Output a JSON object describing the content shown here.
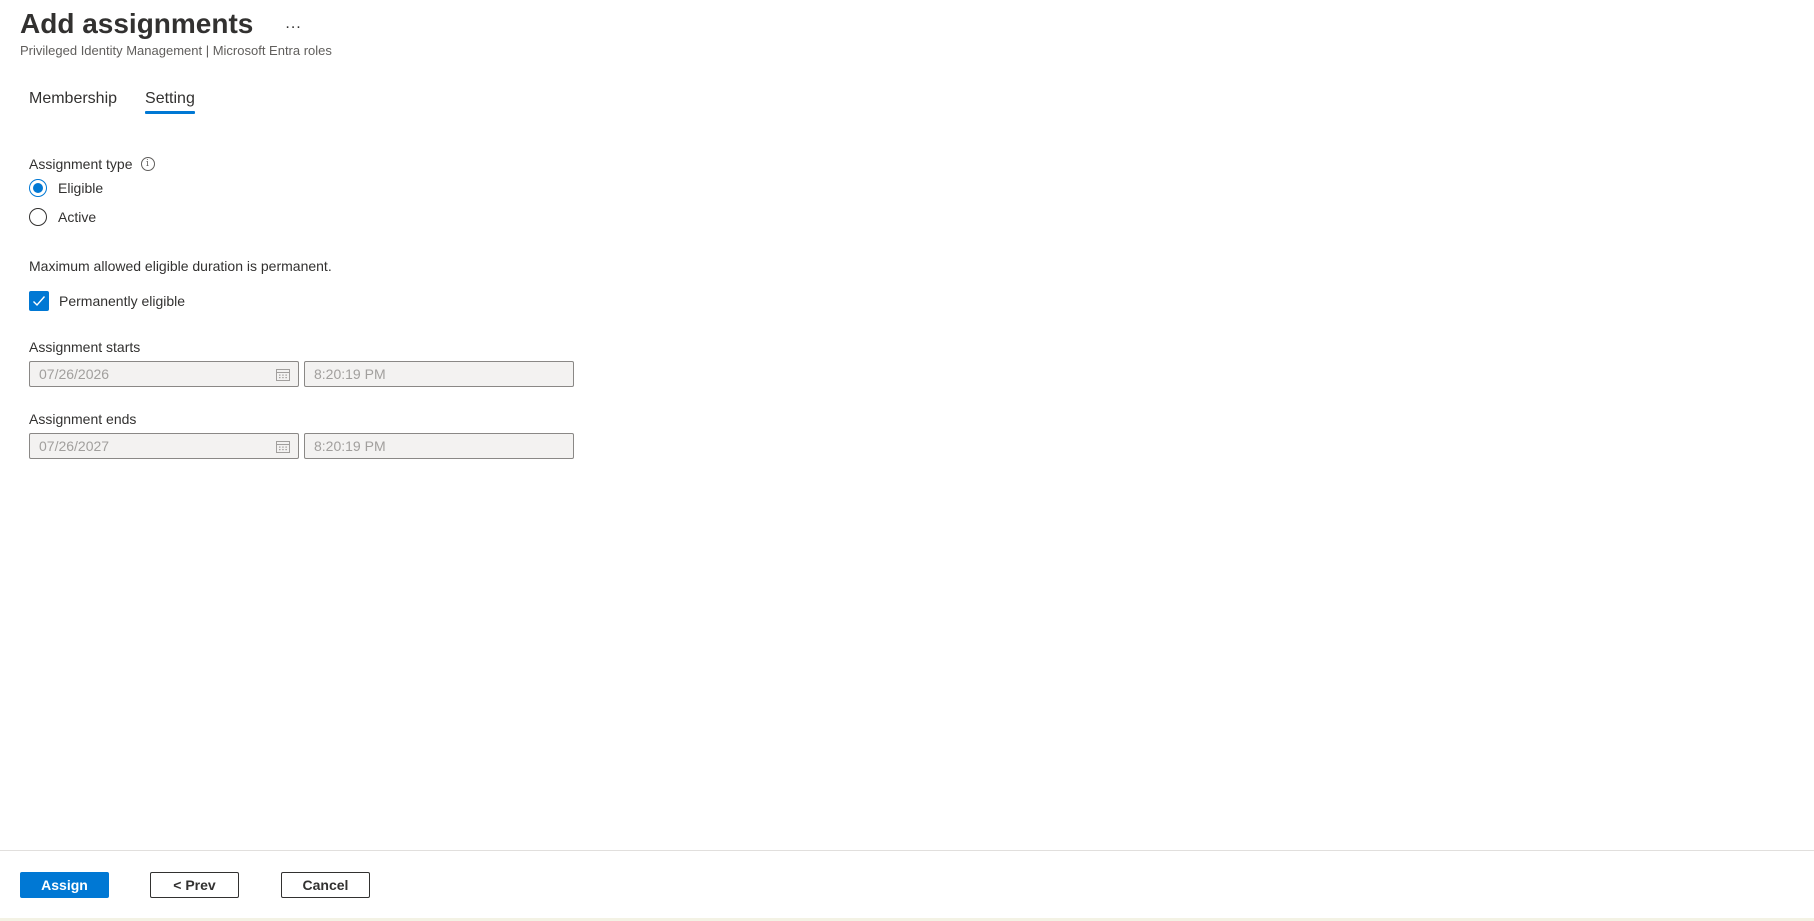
{
  "header": {
    "title": "Add assignments",
    "more_label": "...",
    "subtitle": "Privileged Identity Management | Microsoft Entra roles"
  },
  "tabs": [
    {
      "label": "Membership",
      "active": false
    },
    {
      "label": "Setting",
      "active": true
    }
  ],
  "form": {
    "assignment_type": {
      "label": "Assignment type",
      "info_glyph": "i",
      "options": [
        {
          "label": "Eligible",
          "checked": true
        },
        {
          "label": "Active",
          "checked": false
        }
      ]
    },
    "duration_note": "Maximum allowed eligible duration is permanent.",
    "permanent": {
      "label": "Permanently eligible",
      "checked": true
    },
    "starts": {
      "label": "Assignment starts",
      "date": "07/26/2026",
      "time": "8:20:19 PM",
      "disabled": true
    },
    "ends": {
      "label": "Assignment ends",
      "date": "07/26/2027",
      "time": "8:20:19 PM",
      "disabled": true
    }
  },
  "footer": {
    "assign_label": "Assign",
    "prev_label": "< Prev",
    "cancel_label": "Cancel"
  },
  "colors": {
    "accent": "#0078d4",
    "text": "#323130",
    "subtle_text": "#605e5c",
    "disabled_bg": "#f3f2f1",
    "disabled_text": "#a19f9d"
  },
  "icons": {
    "more": "more-horizontal-icon",
    "info": "info-icon",
    "calendar": "calendar-icon",
    "check": "checkmark-icon"
  }
}
